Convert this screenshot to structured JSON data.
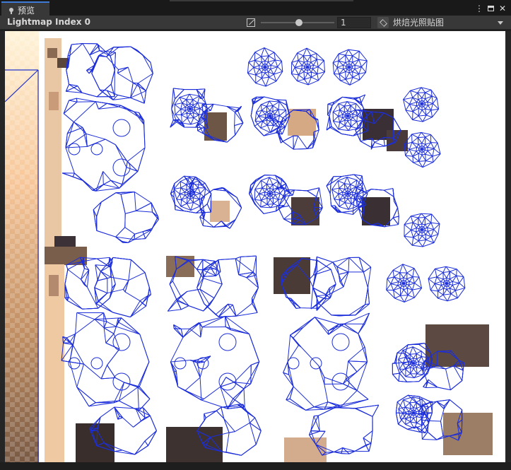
{
  "tab": {
    "label": "预览",
    "icon": "pin-icon"
  },
  "window_buttons": {
    "menu": "⋮",
    "close": "✕"
  },
  "toolbar": {
    "title": "Lightmap Index 0",
    "exposure_value": 0.52,
    "mip_field": "1",
    "mode_dropdown": "烘焙光照贴图"
  },
  "colors": {
    "accent_tab": "#3e7bd6",
    "uv_wire": "#1c2ed9",
    "panel": "#383838"
  },
  "lightmap": {
    "description_items": [
      "uv-wireframe",
      "lightmap-texture"
    ]
  }
}
